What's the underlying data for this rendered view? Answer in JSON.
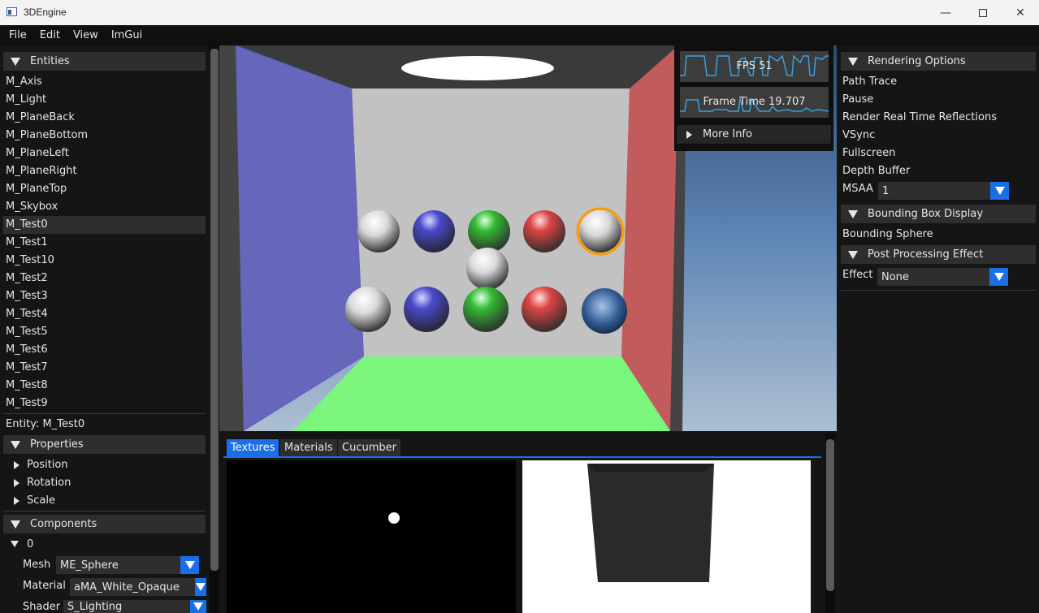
{
  "window": {
    "title": "3DEngine"
  },
  "menu": [
    "File",
    "Edit",
    "View",
    "ImGui"
  ],
  "entities": {
    "header": "Entities",
    "items": [
      "M_Axis",
      "M_Light",
      "M_PlaneBack",
      "M_PlaneBottom",
      "M_PlaneLeft",
      "M_PlaneRight",
      "M_PlaneTop",
      "M_Skybox",
      "M_Test0",
      "M_Test1",
      "M_Test10",
      "M_Test2",
      "M_Test3",
      "M_Test4",
      "M_Test5",
      "M_Test6",
      "M_Test7",
      "M_Test8",
      "M_Test9"
    ],
    "selected": "M_Test0"
  },
  "entity_label": "Entity: M_Test0",
  "properties": {
    "header": "Properties",
    "items": [
      "Position",
      "Rotation",
      "Scale"
    ]
  },
  "components": {
    "header": "Components",
    "index": "0",
    "mesh_label": "Mesh",
    "mesh_value": "ME_Sphere",
    "material_label": "Material",
    "material_value": "aMA_White_Opaque",
    "shader_label": "Shader",
    "shader_value": "S_Lighting"
  },
  "stats": {
    "fps": "FPS 51",
    "frame_time": "Frame Time 19.707",
    "more_info": "More Info"
  },
  "rendering": {
    "header": "Rendering Options",
    "options": [
      "Path Trace",
      "Pause",
      "Render Real Time Reflections",
      "VSync",
      "Fullscreen",
      "Depth Buffer"
    ],
    "msaa_label": "MSAA",
    "msaa_value": "1"
  },
  "bounding": {
    "header": "Bounding Box Display",
    "option": "Bounding Sphere"
  },
  "post": {
    "header": "Post Processing Effect",
    "effect_label": "Effect",
    "effect_value": "None"
  },
  "tabs": [
    "Textures",
    "Materials",
    "Cucumber"
  ],
  "active_tab": "Textures",
  "colors": {
    "accent": "#1a6ee6",
    "panel": "#151515",
    "header": "#2e2e2e",
    "selection_outline": "#ff9900"
  }
}
